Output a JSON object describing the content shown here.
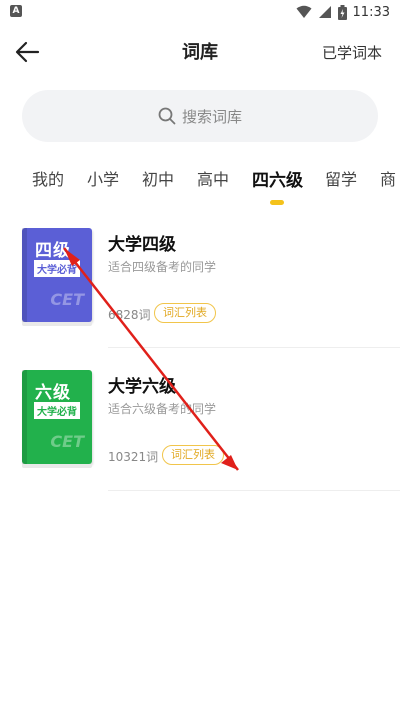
{
  "status_bar": {
    "app_icon_label": "A",
    "time": "11:33",
    "icons": [
      "wifi-icon",
      "signal-icon",
      "battery-icon"
    ]
  },
  "header": {
    "title": "词库",
    "right_action": "已学词本",
    "back_icon": "arrow-left-icon"
  },
  "search": {
    "placeholder": "搜索词库",
    "icon": "search-icon"
  },
  "tabs": [
    {
      "label": "我的",
      "active": false
    },
    {
      "label": "小学",
      "active": false
    },
    {
      "label": "初中",
      "active": false
    },
    {
      "label": "高中",
      "active": false
    },
    {
      "label": "四六级",
      "active": true
    },
    {
      "label": "留学",
      "active": false
    },
    {
      "label": "商",
      "active": false
    }
  ],
  "books": [
    {
      "title": "大学四级",
      "description": "适合四级备考的同学",
      "word_count": "6828词",
      "list_button": "词汇列表",
      "cover": {
        "level": "四级",
        "ribbon": "大学必背",
        "tag": "CET",
        "color": "#5b5fd6"
      }
    },
    {
      "title": "大学六级",
      "description": "适合六级备考的同学",
      "word_count": "10321词",
      "list_button": "词汇列表",
      "cover": {
        "level": "六级",
        "ribbon": "大学必背",
        "tag": "CET",
        "color": "#22b14c"
      }
    }
  ],
  "colors": {
    "accent": "#f4c21b",
    "tag_text": "#e2a923",
    "annotation_arrow": "#e0201a"
  }
}
